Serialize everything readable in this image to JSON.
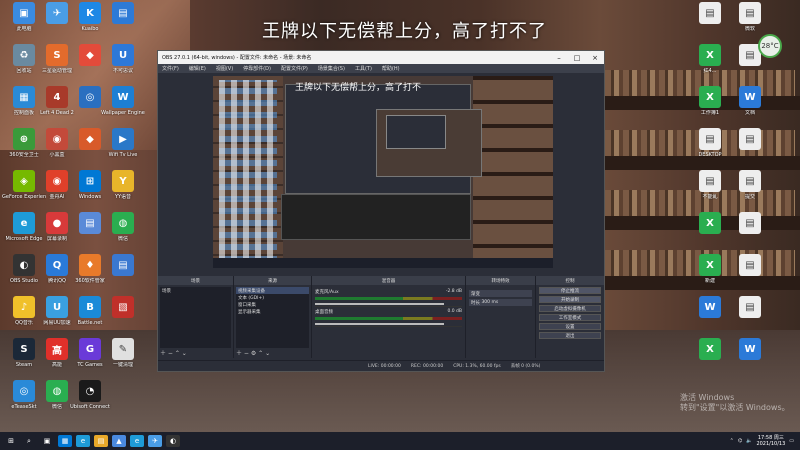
{
  "overlay_text": "王牌以下无偿帮上分，高了打不了",
  "desktop_left_icons": [
    {
      "label": "此电脑",
      "color": "#3a8be0",
      "sym": "▣"
    },
    {
      "label": "",
      "color": "#4a9de6",
      "sym": "✈"
    },
    {
      "label": "Kuaibo",
      "color": "#1e88e5",
      "sym": "K"
    },
    {
      "label": "",
      "color": "#2d7ad6",
      "sym": "▤"
    },
    {
      "label": "回收站",
      "color": "#6a8aa0",
      "sym": "♻"
    },
    {
      "label": "三星驱动管理",
      "color": "#e36b2c",
      "sym": "S"
    },
    {
      "label": "",
      "color": "#e34b3a",
      "sym": "◆"
    },
    {
      "label": "不可思议",
      "color": "#2d78d8",
      "sym": "U"
    },
    {
      "label": "控制面板",
      "color": "#2a8ad6",
      "sym": "▦"
    },
    {
      "label": "Left 4 Dead 2",
      "color": "#a83a2a",
      "sym": "4"
    },
    {
      "label": "",
      "color": "#2a6fc0",
      "sym": "◎"
    },
    {
      "label": "Wallpaper Engine",
      "color": "#1d7fd4",
      "sym": "W"
    },
    {
      "label": "360安全卫士",
      "color": "#3a9a3a",
      "sym": "⊕"
    },
    {
      "label": "小黑盒",
      "color": "#c34a3a",
      "sym": "◉"
    },
    {
      "label": "",
      "color": "#d85a2a",
      "sym": "◆"
    },
    {
      "label": "Wifi Tv Live",
      "color": "#2a78c8",
      "sym": "▶"
    },
    {
      "label": "GeForce Experience",
      "color": "#76b900",
      "sym": "◈"
    },
    {
      "label": "金舟AI",
      "color": "#e0402a",
      "sym": "◉"
    },
    {
      "label": "Windows",
      "color": "#0078d4",
      "sym": "⊞"
    },
    {
      "label": "YY语音",
      "color": "#e8b52a",
      "sym": "Y"
    },
    {
      "label": "Microsoft Edge",
      "color": "#1e9bd7",
      "sym": "e"
    },
    {
      "label": "屏幕录制",
      "color": "#d83a3a",
      "sym": "●"
    },
    {
      "label": "",
      "color": "#5a8ad8",
      "sym": "▤"
    },
    {
      "label": "微信",
      "color": "#2aae50",
      "sym": "◍"
    },
    {
      "label": "OBS Studio",
      "color": "#333333",
      "sym": "◐"
    },
    {
      "label": "腾讯QQ",
      "color": "#2a7ad8",
      "sym": "Q"
    },
    {
      "label": "360软件管家",
      "color": "#e87a2a",
      "sym": "♦"
    },
    {
      "label": "",
      "color": "#3a78d0",
      "sym": "▤"
    },
    {
      "label": "QQ音乐",
      "color": "#f0c02a",
      "sym": "♪"
    },
    {
      "label": "网易UU加速",
      "color": "#3aa0e0",
      "sym": "U"
    },
    {
      "label": "Battle.net",
      "color": "#1a8ad8",
      "sym": "B"
    },
    {
      "label": "",
      "color": "#c0302a",
      "sym": "▧"
    },
    {
      "label": "Steam",
      "color": "#1b2838",
      "sym": "S"
    },
    {
      "label": "高能",
      "color": "#e0302a",
      "sym": "高"
    },
    {
      "label": "TC Games",
      "color": "#6a3ad8",
      "sym": "G"
    },
    {
      "label": "一键清理",
      "color": "#e0e0e0",
      "sym": "✎"
    },
    {
      "label": "eTeaseSkt",
      "color": "#2a8ad8",
      "sym": "◎"
    },
    {
      "label": "微信",
      "color": "#2aae50",
      "sym": "◍"
    },
    {
      "label": "Ubisoft Connect",
      "color": "#1a1a1a",
      "sym": "◔"
    }
  ],
  "desktop_right_icons": [
    {
      "label": "",
      "color": "#eeeeee",
      "sym": "▤"
    },
    {
      "label": "微软",
      "color": "#eeeeee",
      "sym": "▤"
    },
    {
      "label": "红4...",
      "color": "#2aae50",
      "sym": "X"
    },
    {
      "label": "",
      "color": "#eeeeee",
      "sym": "▤"
    },
    {
      "label": "工作簿1",
      "color": "#2aae50",
      "sym": "X"
    },
    {
      "label": "文档",
      "color": "#2b7ad8",
      "sym": "W"
    },
    {
      "label": "DESKTOP",
      "color": "#eeeeee",
      "sym": "▤"
    },
    {
      "label": "",
      "color": "#eeeeee",
      "sym": "▤"
    },
    {
      "label": "不能乱",
      "color": "#eeeeee",
      "sym": "▤"
    },
    {
      "label": "提交",
      "color": "#eeeeee",
      "sym": "▤"
    },
    {
      "label": "",
      "color": "#2aae50",
      "sym": "X"
    },
    {
      "label": "",
      "color": "#eeeeee",
      "sym": "▤"
    },
    {
      "label": "新建",
      "color": "#2aae50",
      "sym": "X"
    },
    {
      "label": "",
      "color": "#eeeeee",
      "sym": "▤"
    },
    {
      "label": "",
      "color": "#2b7ad8",
      "sym": "W"
    },
    {
      "label": "",
      "color": "#eeeeee",
      "sym": "▤"
    },
    {
      "label": "",
      "color": "#2aae50",
      "sym": "X"
    },
    {
      "label": "",
      "color": "#2b7ad8",
      "sym": "W"
    }
  ],
  "weather": {
    "temp": "28°C"
  },
  "obs": {
    "title": "OBS 27.0.1 (64-bit, windows) - 配置文件: 未命名 - 场景: 未命名",
    "menu": [
      "文件(F)",
      "编辑(E)",
      "视图(V)",
      "停靠部件(D)",
      "配置文件(P)",
      "场景集合(S)",
      "工具(T)",
      "帮助(H)"
    ],
    "preview_caption": "王牌以下无偿帮上分，高了打不",
    "dock_scenes": {
      "title": "场景",
      "items": [
        "场景"
      ]
    },
    "dock_sources": {
      "title": "来源",
      "items": [
        "视频采集设备",
        "文本 (GDI+)",
        "窗口采集",
        "显示器采集"
      ]
    },
    "dock_mixer": {
      "title": "混音器",
      "channels": [
        {
          "name": "麦克风/Aux",
          "db": "-2.8 dB"
        },
        {
          "name": "桌面音频",
          "db": "0.0 dB"
        }
      ]
    },
    "dock_transitions": {
      "title": "转场特效",
      "type": "渐变",
      "duration_label": "时长",
      "duration": "300 ms"
    },
    "dock_controls": {
      "title": "控制",
      "buttons": [
        "停止推流",
        "开始录制",
        "启动虚拟摄像机",
        "工作室模式",
        "设置",
        "退出"
      ]
    },
    "status": {
      "live": "LIVE: 00:00:00",
      "rec": "REC: 00:00:00",
      "cpu": "CPU: 1.3%, 60.00 fps",
      "drop": "丢帧 0 (0.0%)"
    }
  },
  "watermark": {
    "line1": "激活 Windows",
    "line2": "转到\"设置\"以激活 Windows。"
  },
  "taskbar": {
    "icons": [
      {
        "sym": "⊞",
        "color": "#1c1f2a"
      },
      {
        "sym": "⌕",
        "color": "#1c1f2a"
      },
      {
        "sym": "▣",
        "color": "#1c1f2a"
      },
      {
        "sym": "▦",
        "color": "#0078d4"
      },
      {
        "sym": "e",
        "color": "#1e9bd7"
      },
      {
        "sym": "▤",
        "color": "#e8a82a"
      },
      {
        "sym": "▲",
        "color": "#4a8ae0"
      },
      {
        "sym": "e",
        "color": "#1e9bd7"
      },
      {
        "sym": "✈",
        "color": "#4a9de6"
      },
      {
        "sym": "◐",
        "color": "#333333"
      }
    ],
    "time": "17:58 周三",
    "date": "2021/10/13"
  }
}
